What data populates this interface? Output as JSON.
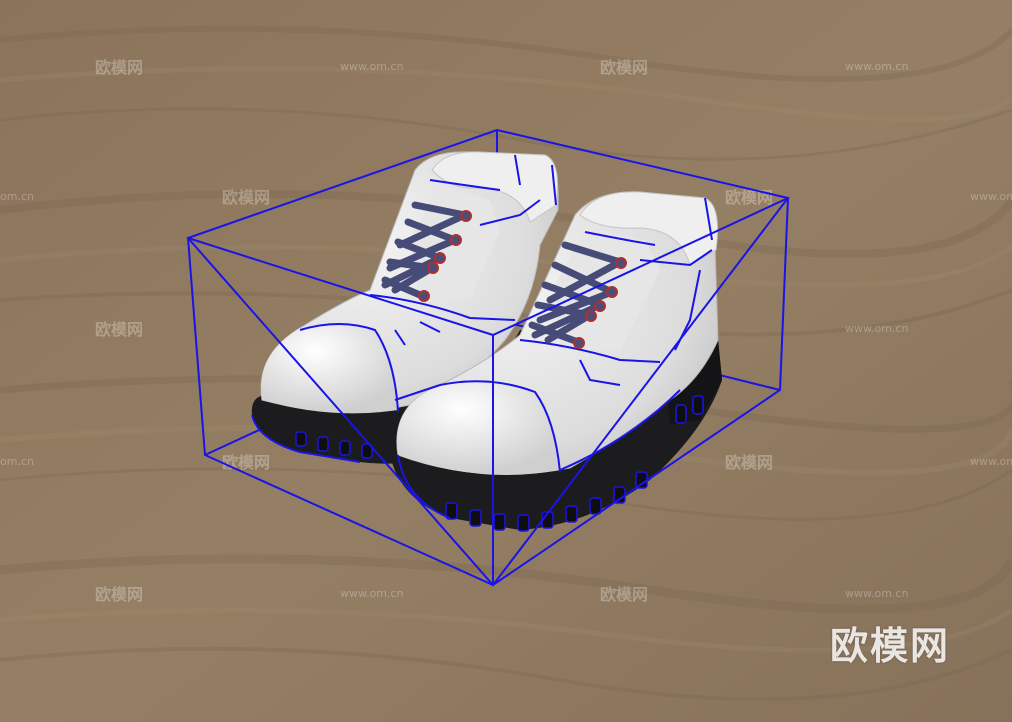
{
  "scene": {
    "colors": {
      "floor": "#8c765c",
      "floor_dark": "#7a6650",
      "boot_upper": "#e4e4e4",
      "sole": "#1c1c1e",
      "selection": "#1a14e6",
      "lace": "#4a4e78",
      "eyelet": "#b03030"
    },
    "objects": [
      {
        "name": "left-boot",
        "icon": "boot-icon"
      },
      {
        "name": "right-boot",
        "icon": "boot-icon"
      }
    ]
  },
  "watermarks": {
    "cn": "欧模网",
    "url": "www.om.cn",
    "url_short": "om.cn"
  },
  "brand": {
    "logo_text": "欧模网"
  }
}
